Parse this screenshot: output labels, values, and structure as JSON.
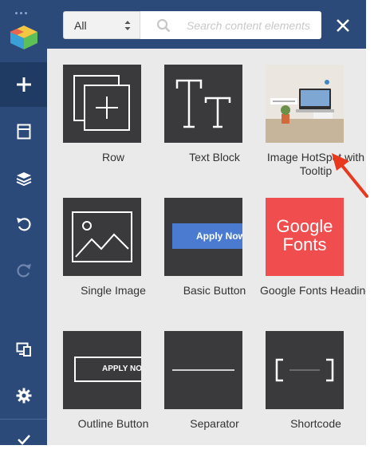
{
  "sidebar": {
    "items": [
      {
        "name": "add-element",
        "icon": "plus-icon"
      },
      {
        "name": "templates",
        "icon": "template-icon"
      },
      {
        "name": "layers",
        "icon": "layers-icon"
      },
      {
        "name": "undo",
        "icon": "undo-icon"
      },
      {
        "name": "redo",
        "icon": "redo-icon"
      },
      {
        "name": "responsive-view",
        "icon": "devices-icon"
      },
      {
        "name": "settings",
        "icon": "gear-icon"
      },
      {
        "name": "publish",
        "icon": "check-icon"
      }
    ]
  },
  "topbar": {
    "filter_value": "All",
    "search_placeholder": "Search content elements"
  },
  "elements": [
    {
      "label": "Row"
    },
    {
      "label": "Text Block"
    },
    {
      "label": "Image HotSpot with Tooltip"
    },
    {
      "label": "Single Image"
    },
    {
      "label": "Basic Button",
      "thumb_text": "Apply Now"
    },
    {
      "label": "Google Fonts Heading",
      "thumb_line1": "Google",
      "thumb_line2": "Fonts"
    },
    {
      "label": "Outline Button",
      "thumb_text": "APPLY NO"
    },
    {
      "label": "Separator"
    },
    {
      "label": "Shortcode"
    }
  ],
  "colors": {
    "sidebar": "#2b4a7a",
    "thumb_dark": "#3a3a3c",
    "google_red": "#f04e4e",
    "button_blue": "#4a7bd1",
    "arrow_red": "#e8391f"
  }
}
